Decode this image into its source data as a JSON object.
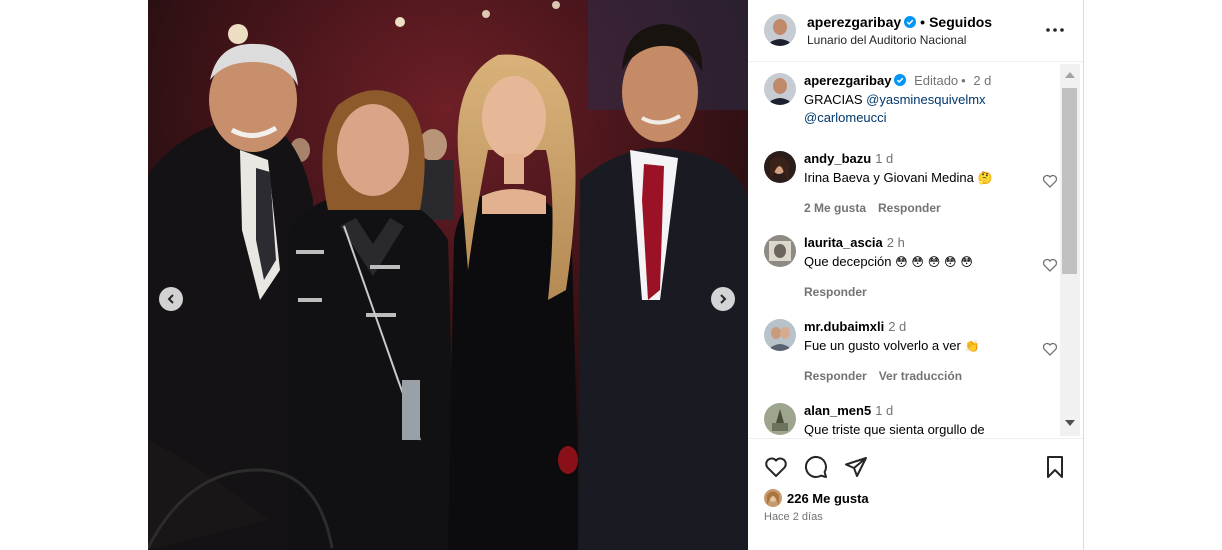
{
  "post": {
    "username": "aperezgaribay",
    "follow_status": "Seguidos",
    "location": "Lunario del Auditorio Nacional"
  },
  "caption": {
    "username": "aperezgaribay",
    "edited": "Editado",
    "time": "2 d",
    "text": "GRACIAS",
    "mention1": "@yasminesquivelmx",
    "mention2": "@carlomeucci"
  },
  "comments": [
    {
      "username": "andy_bazu",
      "time": "1 d",
      "text": "Irina Baeva y Giovani Medina",
      "emoji": "🤔",
      "likes": "2 Me gusta",
      "reply": "Responder",
      "translate": ""
    },
    {
      "username": "laurita_ascia",
      "time": "2 h",
      "text": "Que decepción",
      "emoji": "😳 😳 😳 😳 😳",
      "likes": "",
      "reply": "Responder",
      "translate": ""
    },
    {
      "username": "mr.dubaimxli",
      "time": "2 d",
      "text": "Fue un gusto volverlo a ver",
      "emoji": "👏",
      "likes": "",
      "reply": "Responder",
      "translate": "Ver traducción"
    },
    {
      "username": "alan_men5",
      "time": "1 d",
      "text": "Que triste que sienta orgullo de",
      "emoji": "",
      "likes": "",
      "reply": "",
      "translate": ""
    }
  ],
  "footer": {
    "likes": "226 Me gusta",
    "posted": "Hace 2 días"
  },
  "icons": {
    "like": "heart-icon",
    "comment": "comment-icon",
    "share": "send-icon",
    "save": "bookmark-icon",
    "more": "more-options-icon",
    "prev": "chevron-left-icon",
    "next": "chevron-right-icon"
  },
  "colors": {
    "verified": "#0095f6",
    "mention": "#00376b",
    "muted": "#737373"
  }
}
